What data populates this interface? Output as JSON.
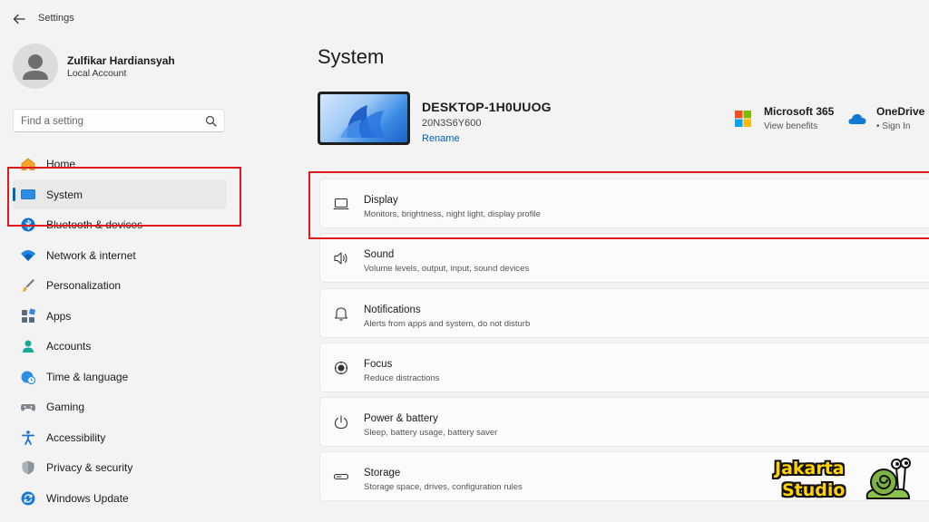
{
  "window": {
    "title": "Settings"
  },
  "profile": {
    "name": "Zulfikar Hardiansyah",
    "account_type": "Local Account"
  },
  "search": {
    "placeholder": "Find a setting"
  },
  "sidebar": {
    "items": [
      {
        "label": "Home",
        "icon": "home-icon"
      },
      {
        "label": "System",
        "icon": "system-icon",
        "active": true
      },
      {
        "label": "Bluetooth & devices",
        "icon": "bluetooth-icon"
      },
      {
        "label": "Network & internet",
        "icon": "wifi-icon"
      },
      {
        "label": "Personalization",
        "icon": "brush-icon"
      },
      {
        "label": "Apps",
        "icon": "apps-icon"
      },
      {
        "label": "Accounts",
        "icon": "person-icon"
      },
      {
        "label": "Time & language",
        "icon": "globe-clock-icon"
      },
      {
        "label": "Gaming",
        "icon": "gamepad-icon"
      },
      {
        "label": "Accessibility",
        "icon": "accessibility-icon"
      },
      {
        "label": "Privacy & security",
        "icon": "shield-icon"
      },
      {
        "label": "Windows Update",
        "icon": "update-icon"
      }
    ]
  },
  "main": {
    "title": "System",
    "device": {
      "name": "DESKTOP-1H0UUOG",
      "model": "20N3S6Y600",
      "rename_label": "Rename"
    },
    "ms365": {
      "title": "Microsoft 365",
      "subtitle": "View benefits"
    },
    "onedrive": {
      "title": "OneDrive",
      "subtitle": "• Sign In"
    },
    "cards": [
      {
        "title": "Display",
        "subtitle": "Monitors, brightness, night light, display profile",
        "icon": "monitor-icon"
      },
      {
        "title": "Sound",
        "subtitle": "Volume levels, output, input, sound devices",
        "icon": "speaker-icon"
      },
      {
        "title": "Notifications",
        "subtitle": "Alerts from apps and system, do not disturb",
        "icon": "bell-icon"
      },
      {
        "title": "Focus",
        "subtitle": "Reduce distractions",
        "icon": "focus-icon"
      },
      {
        "title": "Power & battery",
        "subtitle": "Sleep, battery usage, battery saver",
        "icon": "power-icon"
      },
      {
        "title": "Storage",
        "subtitle": "Storage space, drives, configuration rules",
        "icon": "storage-icon"
      }
    ]
  },
  "watermark": {
    "line1": "Jakarta",
    "line2": "Studio"
  },
  "colors": {
    "accent": "#0067c0",
    "highlight": "#e0191f",
    "link": "#005fb8"
  }
}
